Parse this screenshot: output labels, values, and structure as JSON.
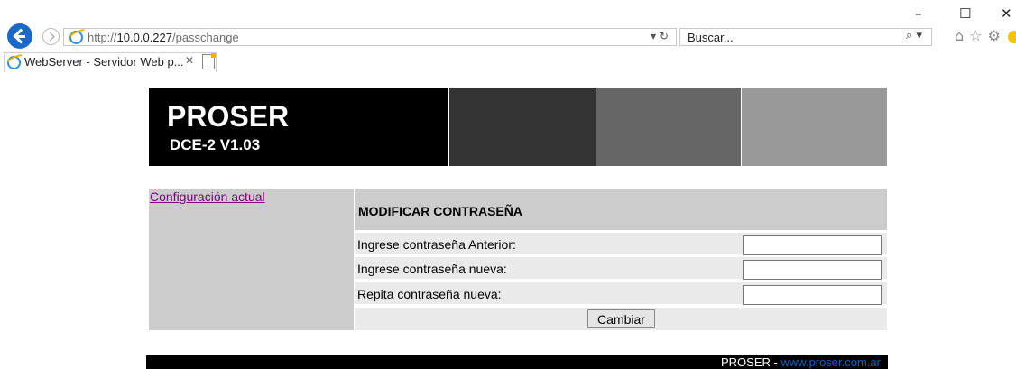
{
  "window": {
    "minimize": "–",
    "maximize": "☐",
    "close": "✕"
  },
  "browser": {
    "url_prefix": "http://",
    "url_host": "10.0.0.227",
    "url_path": "/passchange",
    "url_tools": "▾ ↻",
    "search_placeholder": "Buscar...",
    "search_icon": "⌕ ▾",
    "toolbar_icons": "⌂☆⚙",
    "tab_title": "WebServer - Servidor Web p...",
    "tab_close": "✕"
  },
  "header": {
    "brand": "PROSER",
    "model": "DCE-2 V1.03"
  },
  "sidebar": {
    "link": "Configuración actual"
  },
  "form": {
    "title": "MODIFICAR CONTRASEÑA",
    "rows": [
      {
        "label": "Ingrese contraseña Anterior:",
        "value": ""
      },
      {
        "label": "Ingrese contraseña nueva:",
        "value": ""
      },
      {
        "label": "Repita contraseña nueva:",
        "value": ""
      }
    ],
    "submit": "Cambiar"
  },
  "footer": {
    "text": "PROSER - ",
    "link": "www.proser.com.ar"
  }
}
